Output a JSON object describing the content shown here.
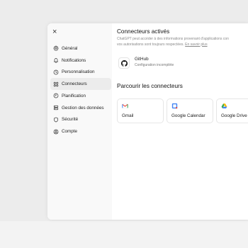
{
  "settings": {
    "close_label": "×",
    "nav": [
      {
        "label": "Général",
        "icon": "gear-icon"
      },
      {
        "label": "Notifications",
        "icon": "bell-icon"
      },
      {
        "label": "Personnalisation",
        "icon": "clock-icon"
      },
      {
        "label": "Connecteurs",
        "icon": "connectors-icon",
        "active": true
      },
      {
        "label": "Planification",
        "icon": "schedule-icon"
      },
      {
        "label": "Gestion des données",
        "icon": "database-icon"
      },
      {
        "label": "Sécurité",
        "icon": "shield-icon"
      },
      {
        "label": "Compte",
        "icon": "user-icon"
      }
    ]
  },
  "connectors": {
    "title": "Connecteurs activés",
    "description_line1": "ChatGPT peut accéder à des informations provenant d'applications con",
    "description_line2": "vos autorisations sont toujours respectées.",
    "learn_more": "En savoir plus",
    "enabled": {
      "name": "GitHub",
      "status": "Configuration incomplète",
      "icon": "github-icon"
    },
    "browse_title": "Parcourir les connecteurs",
    "browse": [
      {
        "label": "Gmail",
        "icon": "gmail-icon"
      },
      {
        "label": "Google Calendar",
        "icon": "google-calendar-icon"
      },
      {
        "label": "Google Drive",
        "icon": "google-drive-icon"
      }
    ]
  },
  "colors": {
    "active_nav": "#ececec",
    "sidebar_bg": "#f9f9f9",
    "gmail_red": "#ea4335",
    "calendar_blue": "#4285f4"
  }
}
